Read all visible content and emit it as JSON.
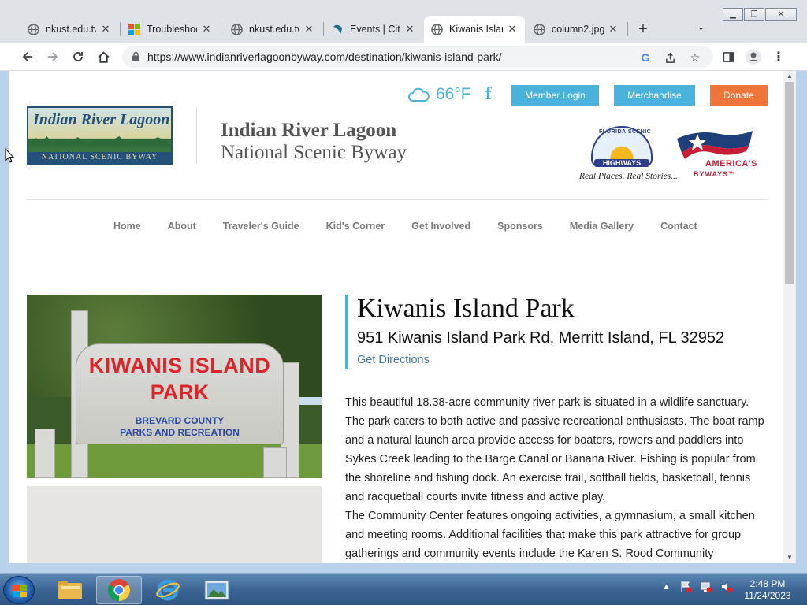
{
  "browser": {
    "tabs": [
      {
        "label": "nkust.edu.tw",
        "icon": "globe-icon",
        "active": false
      },
      {
        "label": "Troubleshoot",
        "icon": "windows-logo-icon",
        "active": false
      },
      {
        "label": "nkust.edu.tw",
        "icon": "globe-icon",
        "active": false
      },
      {
        "label": "Events | Citi",
        "icon": "citi-icon",
        "active": false
      },
      {
        "label": "Kiwanis Islan",
        "icon": "globe-icon",
        "active": true
      },
      {
        "label": "column2.jpg",
        "icon": "globe-icon",
        "active": false
      }
    ],
    "new_tab": "+",
    "url": "https://www.indianriverlagoonbyway.com/destination/kiwanis-island-park/"
  },
  "header": {
    "temperature": "66°F",
    "facebook": "f",
    "member_login": "Member Login",
    "merchandise": "Merchandise",
    "donate": "Donate",
    "logo_script": "Indian River Lagoon",
    "logo_band": "NATIONAL SCENIC BYWAY",
    "title_line1": "Indian River Lagoon",
    "title_line2": "National Scenic Byway",
    "fsh_arc": "FLORIDA SCENIC",
    "fsh_highways": "HIGHWAYS",
    "fsh_tagline": "Real Places. Real Stories...",
    "ab_line1": "AMERICA'S",
    "ab_line2": "BYWAYS™",
    "colors": {
      "accent": "#4ab3dc",
      "donate": "#f0753a",
      "text": "#545454"
    }
  },
  "nav": [
    "Home",
    "About",
    "Traveler's Guide",
    "Kid's Corner",
    "Get Involved",
    "Sponsors",
    "Media Gallery",
    "Contact"
  ],
  "photo": {
    "sign_line1": "KIWANIS ISLAND",
    "sign_line2": "PARK",
    "sign_line3": "BREVARD COUNTY",
    "sign_line4": "PARKS AND RECREATION"
  },
  "park": {
    "name": "Kiwanis Island Park",
    "address": "951 Kiwanis Island Park Rd, Merritt Island, FL 32952",
    "directions": "Get Directions",
    "paragraph1": "This beautiful 18.38-acre community river park is situated in a wildlife sanctuary. The park caters to both active and passive recreational enthusiasts. The boat ramp and a natural launch area provide access for boaters, rowers and paddlers into Sykes Creek leading to the Barge Canal or Banana River. Fishing is popular from the shoreline and fishing dock. An exercise trail, softball fields, basketball, tennis and racquetball courts invite fitness and active play.",
    "paragraph2": "The Community Center features ongoing activities, a gymnasium, a small kitchen and meeting rooms. Additional facilities that make this park attractive for group gatherings and community events include the Karen S. Rood Community"
  },
  "taskbar": {
    "time": "2:48 PM",
    "date": "11/24/2023"
  }
}
